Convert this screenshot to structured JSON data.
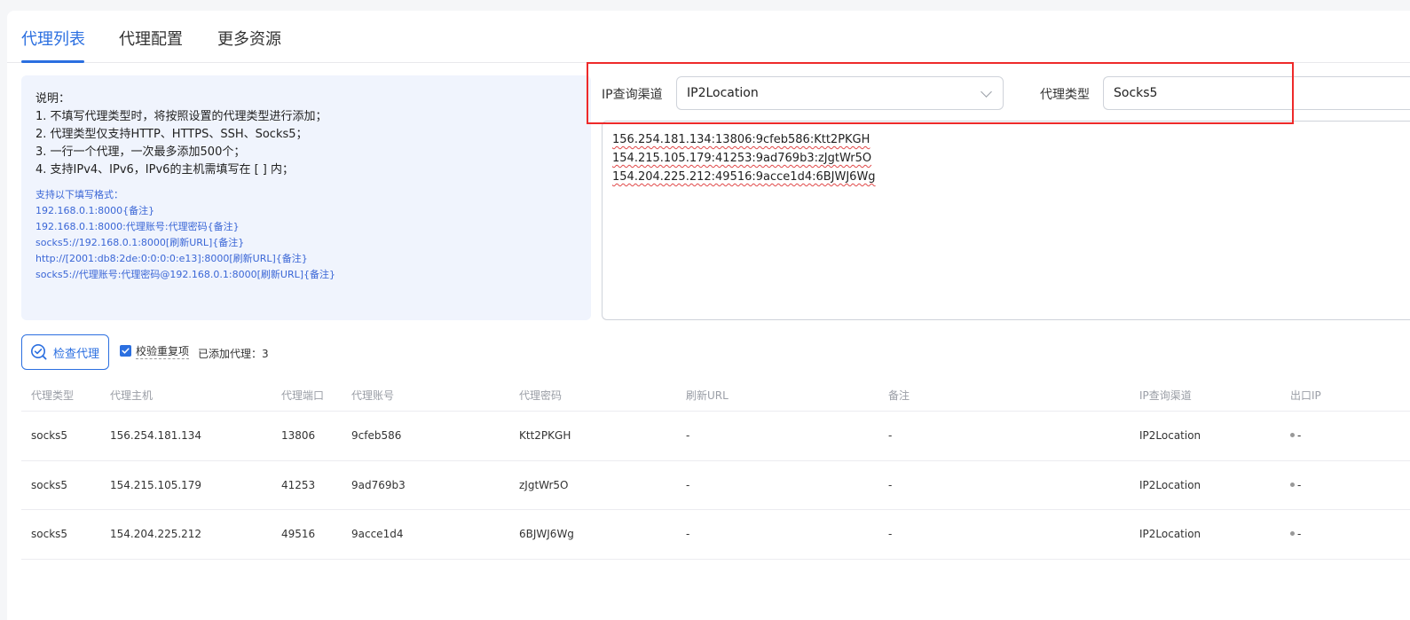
{
  "tabs": [
    {
      "label": "代理列表",
      "active": true
    },
    {
      "label": "代理配置",
      "active": false
    },
    {
      "label": "更多资源",
      "active": false
    }
  ],
  "info": {
    "heading": "说明：",
    "notes": [
      "1. 不填写代理类型时，将按照设置的代理类型进行添加；",
      "2. 代理类型仅支持HTTP、HTTPS、SSH、Socks5；",
      "3. 一行一个代理，一次最多添加500个；",
      "4. 支持IPv4、IPv6，IPv6的主机需填写在 [ ] 内；"
    ],
    "formats_heading": "支持以下填写格式：",
    "formats": [
      "192.168.0.1:8000{备注}",
      "192.168.0.1:8000:代理账号:代理密码{备注}",
      "socks5://192.168.0.1:8000[刷新URL]{备注}",
      "http://[2001:db8:2de:0:0:0:0:e13]:8000[刷新URL]{备注}",
      "socks5://代理账号:代理密码@192.168.0.1:8000[刷新URL]{备注}"
    ]
  },
  "config": {
    "ip_channel_label": "IP查询渠道",
    "ip_channel_value": "IP2Location",
    "proxy_type_label": "代理类型",
    "proxy_type_value": "Socks5"
  },
  "proxy_input_lines": [
    "156.254.181.134:13806:9cfeb586:Ktt2PKGH",
    "154.215.105.179:41253:9ad769b3:zJgtWr5O",
    "154.204.225.212:49516:9acce1d4:6BJWJ6Wg"
  ],
  "toolbar": {
    "check_button": "检查代理",
    "dedupe_label": "校验重复项",
    "dedupe_checked": true,
    "added_count_label": "已添加代理：3"
  },
  "table": {
    "headers": [
      "代理类型",
      "代理主机",
      "代理端口",
      "代理账号",
      "代理密码",
      "刷新URL",
      "备注",
      "IP查询渠道",
      "出口IP"
    ],
    "rows": [
      [
        "socks5",
        "156.254.181.134",
        "13806",
        "9cfeb586",
        "Ktt2PKGH",
        "-",
        "-",
        "IP2Location",
        "-"
      ],
      [
        "socks5",
        "154.215.105.179",
        "41253",
        "9ad769b3",
        "zJgtWr5O",
        "-",
        "-",
        "IP2Location",
        "-"
      ],
      [
        "socks5",
        "154.204.225.212",
        "49516",
        "9acce1d4",
        "6BJWJ6Wg",
        "-",
        "-",
        "IP2Location",
        "-"
      ]
    ]
  },
  "colors": {
    "accent": "#2b6fe0",
    "highlight_box": "#ee2a2a",
    "info_bg": "#f0f4fd",
    "format_text": "#3a66d6"
  }
}
